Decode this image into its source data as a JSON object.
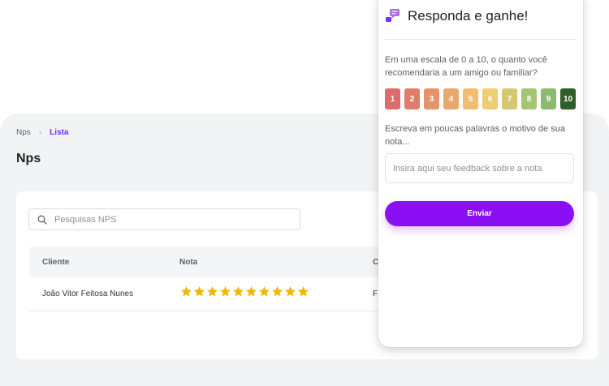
{
  "breadcrumb": {
    "root": "Nps",
    "separator": "›",
    "current": "Lista"
  },
  "page": {
    "title": "Nps"
  },
  "search": {
    "placeholder": "Pesquisas NPS",
    "value": ""
  },
  "table": {
    "columns": [
      "Cliente",
      "Nota",
      "C"
    ],
    "rows": [
      {
        "cliente": "João Vitor Feitosa Nunes",
        "stars": 10,
        "truncated": "F"
      }
    ]
  },
  "survey": {
    "title": "Responda e ganhe!",
    "icon": "survey-chat-icon",
    "question": "Em uma escala de 0 a 10, o quanto você recomendaria a um amigo ou familiar?",
    "scale": [
      {
        "label": "1",
        "color": "#dd6b6b"
      },
      {
        "label": "2",
        "color": "#df7d6c"
      },
      {
        "label": "3",
        "color": "#e5936a"
      },
      {
        "label": "4",
        "color": "#e9a86e"
      },
      {
        "label": "5",
        "color": "#efbe6f"
      },
      {
        "label": "6",
        "color": "#efcd72"
      },
      {
        "label": "7",
        "color": "#d6c870"
      },
      {
        "label": "8",
        "color": "#a6c273"
      },
      {
        "label": "9",
        "color": "#8cba70"
      },
      {
        "label": "10",
        "color": "#2e5f2a"
      }
    ],
    "reason_label": "Escreva em poucas palavras o motivo de sua nota...",
    "feedback_placeholder": "Insira aqui seu feedback sobre a nota",
    "submit_label": "Enviar"
  },
  "colors": {
    "accent": "#7b2ff7",
    "submit": "#8a0ff2",
    "star": "#f2b705"
  }
}
